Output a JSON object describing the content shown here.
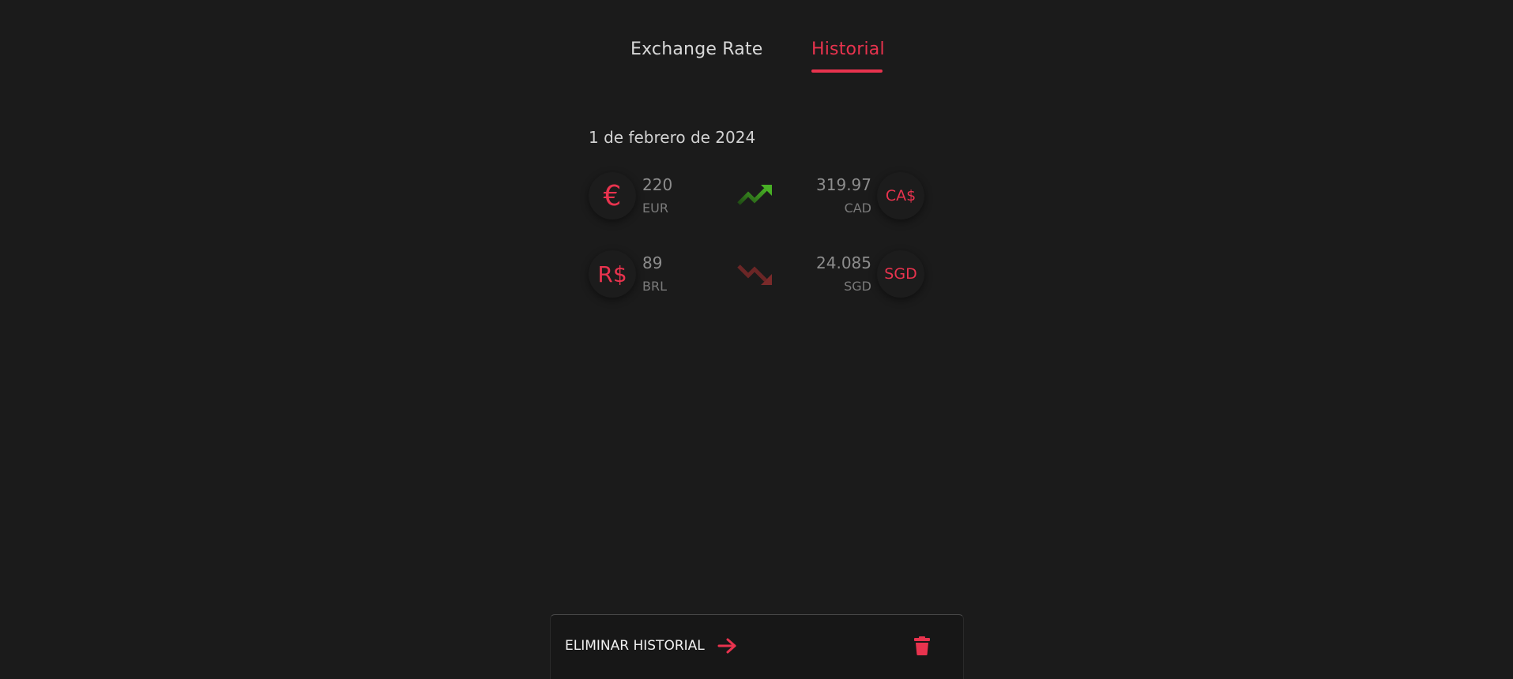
{
  "tabs": {
    "exchange_rate": "Exchange Rate",
    "historial": "Historial",
    "active": "historial"
  },
  "history": {
    "date": "1 de febrero de 2024",
    "entries": [
      {
        "from": {
          "symbol": "€",
          "amount": "220",
          "code": "EUR"
        },
        "trend": "up",
        "to": {
          "symbol": "CA$",
          "amount": "319.97",
          "code": "CAD"
        }
      },
      {
        "from": {
          "symbol": "R$",
          "amount": "89",
          "code": "BRL"
        },
        "trend": "down",
        "to": {
          "symbol": "SGD",
          "amount": "24.085",
          "code": "SGD"
        }
      }
    ]
  },
  "footer": {
    "clear_label": "ELIMINAR HISTORIAL",
    "clear_icon": "arrow-right-icon",
    "delete_icon": "trash-icon"
  },
  "colors": {
    "accent": "#e8334e",
    "background": "#1b1b1b",
    "trend_up": "#3d9a1f",
    "trend_down": "#7a2a2a"
  }
}
